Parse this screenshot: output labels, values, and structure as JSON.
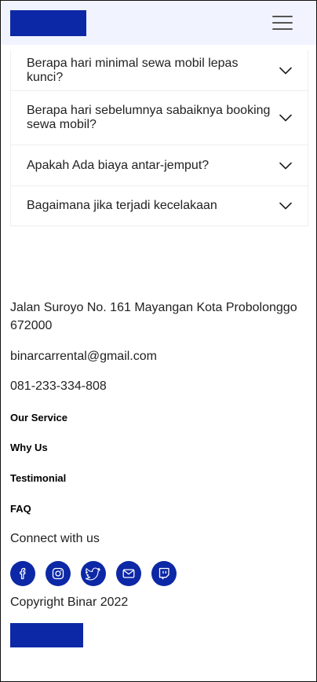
{
  "navbar": {
    "logo": "brand-logo",
    "menu_icon": "hamburger-menu-icon"
  },
  "faq": [
    {
      "question": "Berapa hari minimal sewa mobil lepas kunci?"
    },
    {
      "question": "Berapa hari sebelumnya sabaiknya booking sewa mobil?"
    },
    {
      "question": "Apakah Ada biaya antar-jemput?"
    },
    {
      "question": "Bagaimana jika terjadi kecelakaan"
    }
  ],
  "footer": {
    "address": "Jalan Suroyo No. 161 Mayangan Kota Probolonggo 672000",
    "email": "binarcarrental@gmail.com",
    "phone": "081-233-334-808",
    "links": [
      "Our Service",
      "Why Us",
      "Testimonial",
      "FAQ"
    ],
    "connect_label": "Connect with us",
    "socials": [
      "facebook-icon",
      "instagram-icon",
      "twitter-icon",
      "mail-icon",
      "twitch-icon"
    ],
    "copyright": "Copyright Binar 2022"
  },
  "colors": {
    "brand": "#0d28a6",
    "navbar_bg": "#f1f3fe",
    "text": "#222222"
  }
}
